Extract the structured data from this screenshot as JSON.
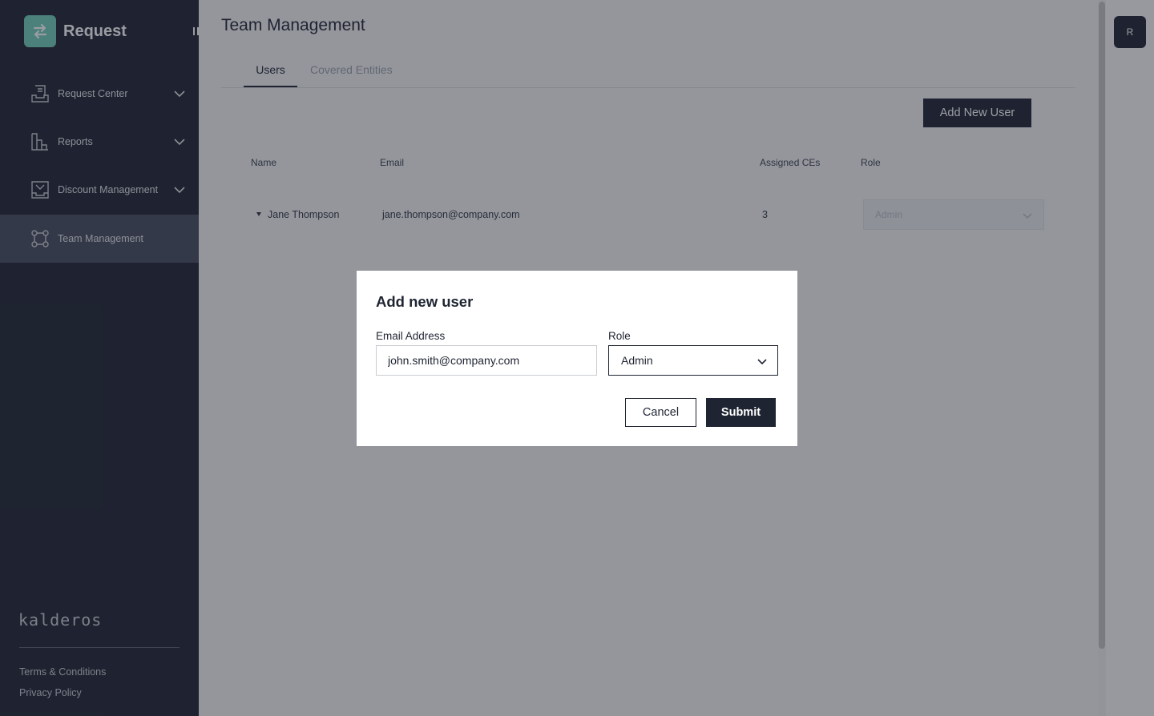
{
  "brand": {
    "name": "Request",
    "logo_icon": "arrows-exchange-icon",
    "accent": "#6fcdb9"
  },
  "sidebar": {
    "items": [
      {
        "label": "Request Center",
        "icon": "inbox-tray-icon",
        "expandable": true
      },
      {
        "label": "Reports",
        "icon": "bar-chart-icon",
        "expandable": true
      },
      {
        "label": "Discount Management",
        "icon": "discount-tray-icon",
        "expandable": true
      },
      {
        "label": "Team Management",
        "icon": "team-nodes-icon",
        "expandable": false,
        "active": true
      }
    ],
    "footer_logo": "kalderos",
    "links": [
      "Terms & Conditions",
      "Privacy Policy"
    ]
  },
  "main": {
    "title": "Team Management",
    "tabs": [
      {
        "label": "Users",
        "active": true
      },
      {
        "label": "Covered Entities",
        "active": false
      }
    ],
    "add_user_label": "Add New User",
    "table": {
      "headers": [
        "Name",
        "Email",
        "Assigned CEs",
        "Role"
      ],
      "rows": [
        {
          "name": "Jane Thompson",
          "email": "jane.thompson@company.com",
          "assigned_ces": "3",
          "role": "Admin"
        }
      ]
    }
  },
  "avatar": {
    "initial": "R"
  },
  "modal": {
    "title": "Add new user",
    "email_label": "Email Address",
    "email_value": "john.smith@company.com",
    "role_label": "Role",
    "role_value": "Admin",
    "cancel_label": "Cancel",
    "submit_label": "Submit"
  },
  "colors": {
    "sidebar_bg": "#1f2432",
    "primary": "#1f2432",
    "active_nav": "#454c5d"
  }
}
